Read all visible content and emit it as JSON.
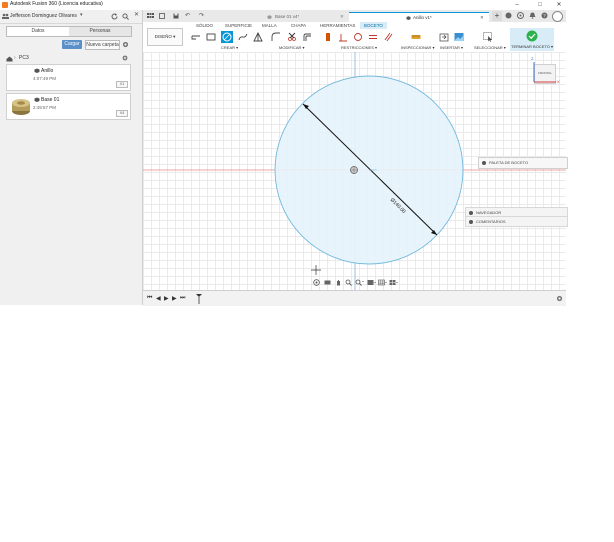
{
  "window": {
    "title": "Autodesk Fusion 360 (Licencia educativa)",
    "controls": [
      "–",
      "□",
      "✕"
    ]
  },
  "sidebar": {
    "user_name": "Jefferson Dominguez Olivares",
    "tabs": [
      "Datos",
      "Personas"
    ],
    "upload_label": "Cargar",
    "new_folder_label": "Nueva carpeta",
    "breadcrumb": "PC3",
    "files": [
      {
        "name": "Anillo",
        "date": "4:07:49 PM",
        "version": "V1"
      },
      {
        "name": "Base 01",
        "date": "2:49:57 PM",
        "version": "V4"
      }
    ]
  },
  "doc_tabs": [
    {
      "label": "Base 01 v4*",
      "active": false
    },
    {
      "label": "Anillo v1*",
      "active": true
    }
  ],
  "ribbon": {
    "workspace_label": "DISEÑO ▾",
    "tabs": [
      "SÓLIDO",
      "SUPERFICIE",
      "MALLA",
      "CHAPA",
      "HERRAMIENTAS",
      "BOCETO"
    ],
    "active_tab": "BOCETO",
    "groups": [
      "CREAR ▾",
      "MODIFICAR ▾",
      "RESTRICCIONES ▾",
      "INSPECCIONAR ▾",
      "INSERTAR ▾",
      "SELECCIONAR ▾"
    ],
    "finish_label": "TERMINAR BOCETO ▾"
  },
  "viewcube": {
    "face_label": "FRONTAL",
    "axis_x": "X",
    "axis_z": "Z"
  },
  "sketch": {
    "dimension_label": "Ø140.00"
  },
  "panels": {
    "sketch_palette": "PALETA DE BOCETO",
    "browser": "NAVEGADOR",
    "comments": "COMENTARIOS"
  },
  "colors": {
    "circle_fill": "#e6f3fb",
    "circle_stroke": "#74b9dd",
    "axis_red": "#e88a8a",
    "axis_blue": "#8aaee0",
    "accent_blue": "#0696d7",
    "finish_green": "#2bb24c"
  }
}
